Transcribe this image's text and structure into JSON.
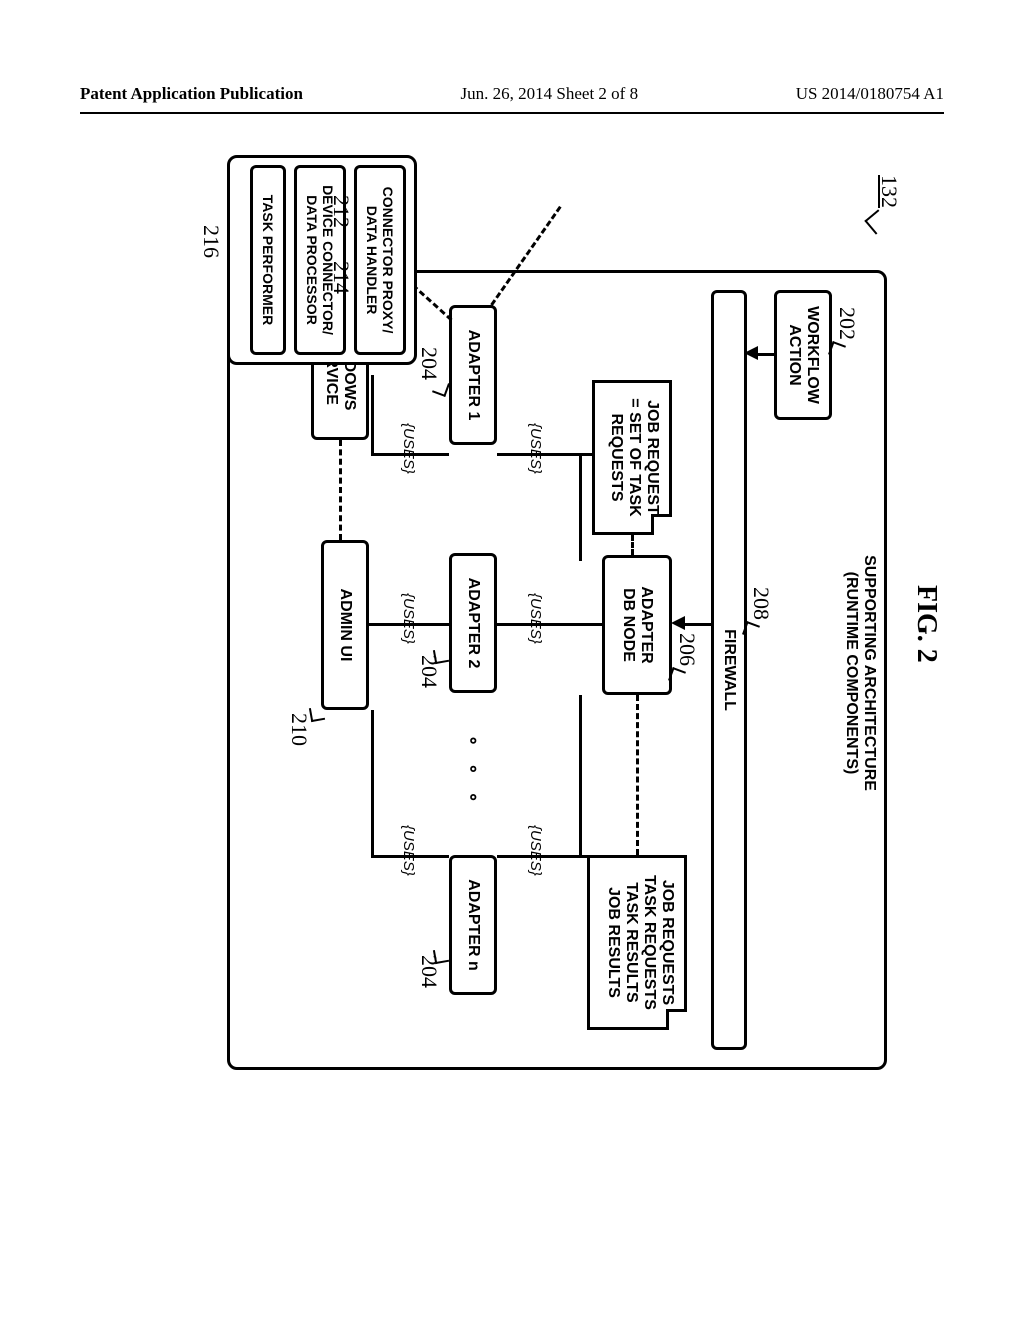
{
  "header": {
    "left": "Patent Application Publication",
    "mid": "Jun. 26, 2014  Sheet 2 of 8",
    "right": "US 2014/0180754 A1"
  },
  "figure": {
    "title": "FIG. 2",
    "ref_main": "132",
    "arch_title_l1": "SUPPORTING ARCHITECTURE",
    "arch_title_l2": "(RUNTIME COMPONENTS)",
    "workflow": "WORKFLOW\nACTION",
    "firewall": "FIREWALL",
    "db_node": "ADAPTER\nDB NODE",
    "note1_l1": "JOB REQUEST",
    "note1_l2": "= SET OF TASK",
    "note1_l3": "REQUESTS",
    "note2_l1": "JOB REQUESTS",
    "note2_l2": "TASK REQUESTS",
    "note2_l3": "TASK RESULTS",
    "note2_l4": "JOB RESULTS",
    "adapter1": "ADAPTER 1",
    "adapter2": "ADAPTER 2",
    "adaptern": "ADAPTER n",
    "windows_service": "WINDOWS\nSERVICE",
    "admin_ui": "ADMIN UI",
    "uses": "{USES}",
    "detail_l1": "CONNECTOR PROXY/",
    "detail_l2": "DATA HANDLER",
    "detail_l3": "DEVICE CONNECTOR/",
    "detail_l4": "DATA PROCESSOR",
    "detail_l5": "TASK PERFORMER",
    "refs": {
      "r202": "202",
      "r204": "204",
      "r206": "206",
      "r208": "208",
      "r210": "210",
      "r212": "212",
      "r214": "214",
      "r216": "216"
    }
  }
}
